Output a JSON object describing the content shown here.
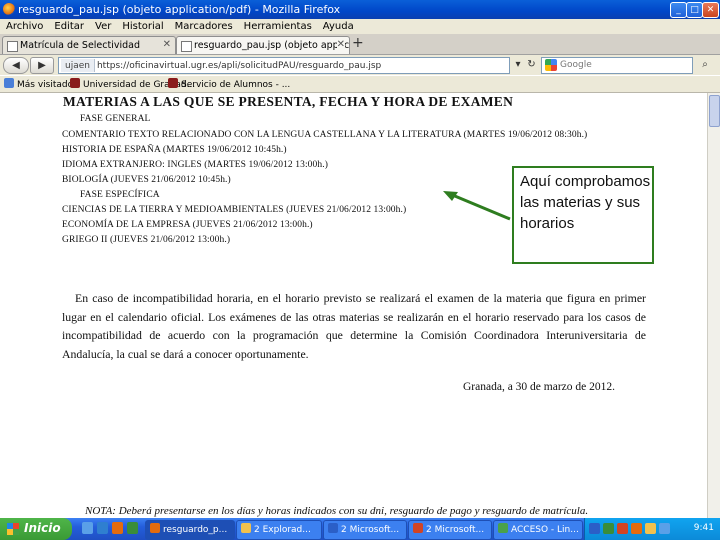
{
  "window": {
    "title": "resguardo_pau.jsp (objeto application/pdf) - Mozilla Firefox",
    "controls": [
      "_",
      "□",
      "✕"
    ]
  },
  "menu": [
    "Archivo",
    "Editar",
    "Ver",
    "Historial",
    "Marcadores",
    "Herramientas",
    "Ayuda"
  ],
  "tabs": [
    {
      "label": "Matrícula de Selectividad",
      "active": false
    },
    {
      "label": "resguardo_pau.jsp (objeto application/pdf)",
      "active": true
    }
  ],
  "new_tab": "+",
  "nav": {
    "back": "◀",
    "forward": "▶",
    "site_label": "ujaen",
    "url": "https://oficinavirtual.ugr.es/apli/solicitudPAU/resguardo_pau.jsp",
    "search_placeholder": "Google"
  },
  "bookmarks": [
    "Más visitados",
    "Universidad de Granad...",
    "Servicio de Alumnos - ..."
  ],
  "document": {
    "heading": "MATERIAS A LAS QUE SE PRESENTA, FECHA Y HORA DE EXAMEN",
    "lines": [
      "FASE GENERAL",
      "COMENTARIO TEXTO RELACIONADO CON LA LENGUA CASTELLANA Y LA LITERATURA  (MARTES 19/06/2012  08:30h.)",
      "HISTORIA DE ESPAÑA  (MARTES 19/06/2012  10:45h.)",
      "IDIOMA EXTRANJERO: INGLES  (MARTES 19/06/2012  13:00h.)",
      "BIOLOGÍA  (JUEVES 21/06/2012  10:45h.)",
      "FASE ESPECÍFICA",
      "CIENCIAS DE LA TIERRA Y MEDIOAMBIENTALES  (JUEVES 21/06/2012  13:00h.)",
      "ECONOMÍA DE LA EMPRESA  (JUEVES 21/06/2012  13:00h.)",
      "GRIEGO II  (JUEVES 21/06/2012  13:00h.)"
    ],
    "paragraph": "En caso de incompatibilidad horaria, en el horario previsto se realizará el examen de la materia que figura en primer lugar en el calendario oficial. Los exámenes de las otras materias se realizarán en el horario reservado para los casos de incompatibilidad de acuerdo con la programación que determine la Comisión Coordinadora Interuniversitaria de Andalucía, la cual se dará a conocer oportunamente.",
    "date": "Granada, a 30 de marzo de 2012.",
    "note": "NOTA: Deberá presentarse en los días y horas indicados con su dni, resguardo de pago y resguardo de matrícula."
  },
  "callout": {
    "text": "Aquí comprobamos las materias y sus horarios",
    "border_color": "#2e7d1f"
  },
  "taskbar": {
    "start": "Inicio",
    "tasks": [
      {
        "label": "resguardo_p...",
        "icon_color": "#e36b0e",
        "active": true
      },
      {
        "label": "2 Explorad...",
        "icon_color": "#f2c14e",
        "active": false
      },
      {
        "label": "2 Microsoft...",
        "icon_color": "#2b5fc7",
        "active": false
      },
      {
        "label": "2 Microsoft...",
        "icon_color": "#d14424",
        "active": false
      },
      {
        "label": "ACCESO - Lin...",
        "icon_color": "#4aa14a",
        "active": false
      }
    ],
    "clock": "9:41"
  }
}
